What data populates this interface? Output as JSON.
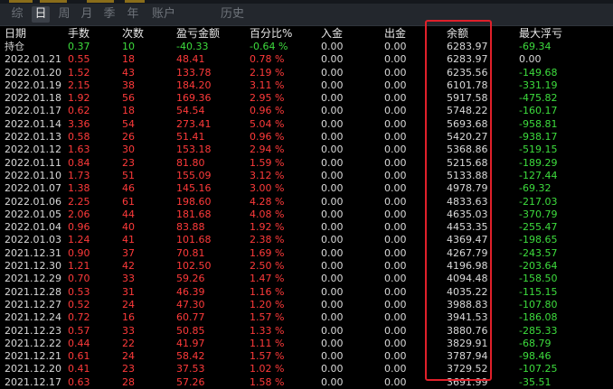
{
  "tabs": [
    {
      "label": "综",
      "active": false
    },
    {
      "label": "日",
      "active": true
    },
    {
      "label": "周",
      "active": false
    },
    {
      "label": "月",
      "active": false
    },
    {
      "label": "季",
      "active": false
    },
    {
      "label": "年",
      "active": false
    },
    {
      "label": "账户",
      "active": false
    },
    {
      "label": "历史",
      "active": false
    }
  ],
  "columns": [
    "日期",
    "手数",
    "次数",
    "盈亏金额",
    "百分比%",
    "入金",
    "出金",
    "余额",
    "最大浮亏"
  ],
  "colors": {
    "gain": "#ff3a3a",
    "loss": "#3ddc3d",
    "highlight": "#e0202a",
    "tab_active": "#3b4048"
  },
  "holding": [
    "持仓",
    "0.37",
    "10",
    "-40.33",
    "-0.64 %",
    "0.00",
    "0.00",
    "6283.97",
    "-69.34"
  ],
  "rows": [
    [
      "2022.01.21",
      "0.55",
      "18",
      "48.41",
      "0.78 %",
      "0.00",
      "0.00",
      "6283.97",
      "0.00"
    ],
    [
      "2022.01.20",
      "1.52",
      "43",
      "133.78",
      "2.19 %",
      "0.00",
      "0.00",
      "6235.56",
      "-149.68"
    ],
    [
      "2022.01.19",
      "2.15",
      "38",
      "184.20",
      "3.11 %",
      "0.00",
      "0.00",
      "6101.78",
      "-331.19"
    ],
    [
      "2022.01.18",
      "1.92",
      "56",
      "169.36",
      "2.95 %",
      "0.00",
      "0.00",
      "5917.58",
      "-475.82"
    ],
    [
      "2022.01.17",
      "0.62",
      "18",
      "54.54",
      "0.96 %",
      "0.00",
      "0.00",
      "5748.22",
      "-160.17"
    ],
    [
      "2022.01.14",
      "3.36",
      "54",
      "273.41",
      "5.04 %",
      "0.00",
      "0.00",
      "5693.68",
      "-958.81"
    ],
    [
      "2022.01.13",
      "0.58",
      "26",
      "51.41",
      "0.96 %",
      "0.00",
      "0.00",
      "5420.27",
      "-938.17"
    ],
    [
      "2022.01.12",
      "1.63",
      "30",
      "153.18",
      "2.94 %",
      "0.00",
      "0.00",
      "5368.86",
      "-519.15"
    ],
    [
      "2022.01.11",
      "0.84",
      "23",
      "81.80",
      "1.59 %",
      "0.00",
      "0.00",
      "5215.68",
      "-189.29"
    ],
    [
      "2022.01.10",
      "1.73",
      "51",
      "155.09",
      "3.12 %",
      "0.00",
      "0.00",
      "5133.88",
      "-127.44"
    ],
    [
      "2022.01.07",
      "1.38",
      "46",
      "145.16",
      "3.00 %",
      "0.00",
      "0.00",
      "4978.79",
      "-69.32"
    ],
    [
      "2022.01.06",
      "2.25",
      "61",
      "198.60",
      "4.28 %",
      "0.00",
      "0.00",
      "4833.63",
      "-217.03"
    ],
    [
      "2022.01.05",
      "2.06",
      "44",
      "181.68",
      "4.08 %",
      "0.00",
      "0.00",
      "4635.03",
      "-370.79"
    ],
    [
      "2022.01.04",
      "0.96",
      "40",
      "83.88",
      "1.92 %",
      "0.00",
      "0.00",
      "4453.35",
      "-255.47"
    ],
    [
      "2022.01.03",
      "1.24",
      "41",
      "101.68",
      "2.38 %",
      "0.00",
      "0.00",
      "4369.47",
      "-198.65"
    ],
    [
      "2021.12.31",
      "0.90",
      "37",
      "70.81",
      "1.69 %",
      "0.00",
      "0.00",
      "4267.79",
      "-243.57"
    ],
    [
      "2021.12.30",
      "1.21",
      "42",
      "102.50",
      "2.50 %",
      "0.00",
      "0.00",
      "4196.98",
      "-203.64"
    ],
    [
      "2021.12.29",
      "0.70",
      "33",
      "59.26",
      "1.47 %",
      "0.00",
      "0.00",
      "4094.48",
      "-158.50"
    ],
    [
      "2021.12.28",
      "0.53",
      "31",
      "46.39",
      "1.16 %",
      "0.00",
      "0.00",
      "4035.22",
      "-115.15"
    ],
    [
      "2021.12.27",
      "0.52",
      "24",
      "47.30",
      "1.20 %",
      "0.00",
      "0.00",
      "3988.83",
      "-107.80"
    ],
    [
      "2021.12.24",
      "0.72",
      "16",
      "60.77",
      "1.57 %",
      "0.00",
      "0.00",
      "3941.53",
      "-186.08"
    ],
    [
      "2021.12.23",
      "0.57",
      "33",
      "50.85",
      "1.33 %",
      "0.00",
      "0.00",
      "3880.76",
      "-285.33"
    ],
    [
      "2021.12.22",
      "0.44",
      "22",
      "41.97",
      "1.11 %",
      "0.00",
      "0.00",
      "3829.91",
      "-68.79"
    ],
    [
      "2021.12.21",
      "0.61",
      "24",
      "58.42",
      "1.57 %",
      "0.00",
      "0.00",
      "3787.94",
      "-98.46"
    ],
    [
      "2021.12.20",
      "0.41",
      "23",
      "37.53",
      "1.02 %",
      "0.00",
      "0.00",
      "3729.52",
      "-107.25"
    ],
    [
      "2021.12.17",
      "0.63",
      "28",
      "57.26",
      "1.58 %",
      "0.00",
      "0.00",
      "3691.99",
      "-35.51"
    ]
  ]
}
